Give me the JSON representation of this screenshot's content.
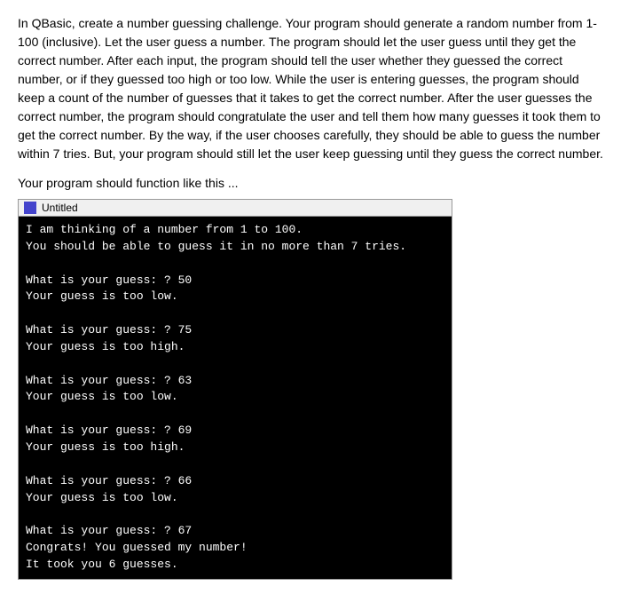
{
  "description": "In QBasic, create a number guessing challenge. Your program should generate a random number from 1-100 (inclusive). Let the user guess a number.  The program should let the user guess until they get the correct number. After each input, the program should tell the user whether they guessed the correct number, or if they guessed too high or too low. While the user is entering guesses, the program should keep a count of the number of guesses that it takes to get the correct number. After the user guesses the correct number, the program should congratulate the user and tell them how many guesses it took them to get the correct number.  By the way, if the user chooses carefully, they should be able to guess the number within 7 tries.  But, your program should still let the user keep guessing until they guess the correct number.",
  "your_program_label": "Your program should function like this ...",
  "terminal": {
    "title": "Untitled",
    "lines": "I am thinking of a number from 1 to 100.\nYou should be able to guess it in no more than 7 tries.\n\nWhat is your guess: ? 50\nYour guess is too low.\n\nWhat is your guess: ? 75\nYour guess is too high.\n\nWhat is your guess: ? 63\nYour guess is too low.\n\nWhat is your guess: ? 69\nYour guess is too high.\n\nWhat is your guess: ? 66\nYour guess is too low.\n\nWhat is your guess: ? 67\nCongrats! You guessed my number!\nIt took you 6 guesses."
  }
}
